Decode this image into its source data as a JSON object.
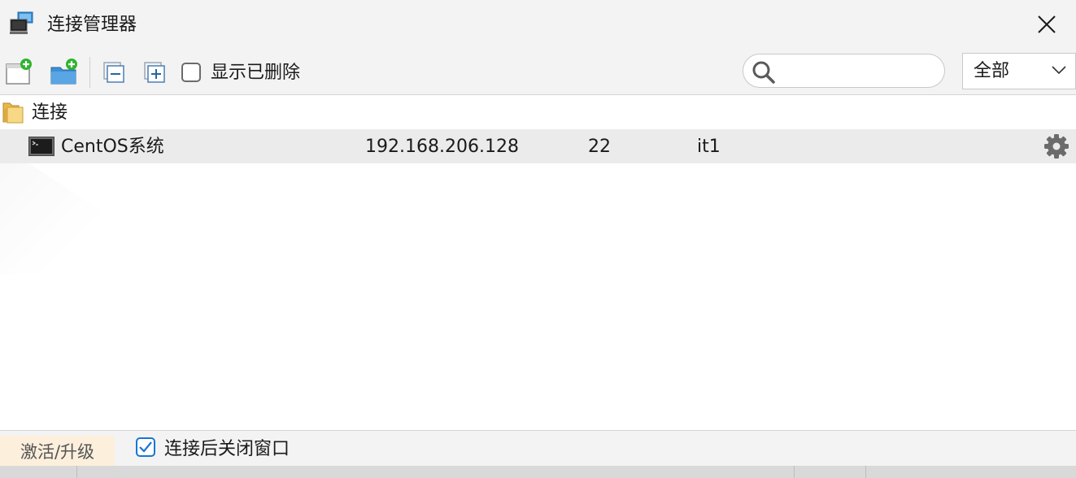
{
  "window": {
    "title": "连接管理器"
  },
  "toolbar": {
    "show_deleted_label": "显示已删除",
    "show_deleted_checked": false,
    "search": {
      "placeholder": "",
      "value": ""
    },
    "filter": {
      "selected": "全部"
    }
  },
  "tree": {
    "group": {
      "label": "连接"
    },
    "connections": [
      {
        "name": "CentOS系统",
        "host": "192.168.206.128",
        "port": "22",
        "user": "it1"
      }
    ]
  },
  "footer": {
    "activate_label": "激活/升级",
    "close_after_connect_label": "连接后关闭窗口",
    "close_after_connect_checked": true
  },
  "colors": {
    "accent": "#1976d2",
    "selected_row": "#ebebeb",
    "activate_bg": "#fcefdc",
    "add_green": "#2db52d",
    "folder_blue": "#3b8fd6"
  },
  "icons": {
    "app": "connection-manager-icon",
    "close": "close-icon",
    "new_session": "new-session-icon",
    "new_folder": "new-folder-icon",
    "collapse_all": "collapse-all-icon",
    "expand_all": "expand-all-icon",
    "search": "search-icon",
    "dropdown": "chevron-down-icon",
    "group": "folder-icon",
    "connection": "terminal-icon",
    "settings": "gear-icon",
    "checkbox": "checkmark-icon"
  }
}
